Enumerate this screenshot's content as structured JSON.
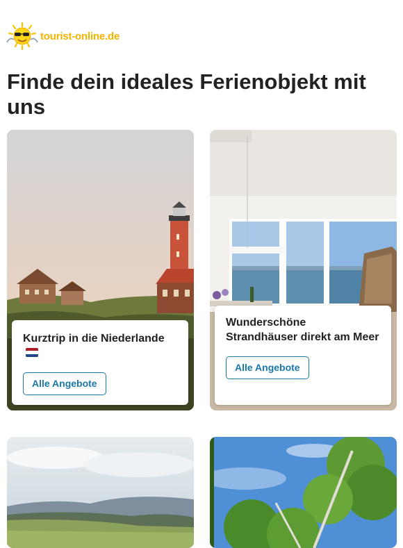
{
  "brand": {
    "name": "tourist-online.de",
    "color": "#f3b400"
  },
  "headline": "Finde dein ideales Ferienobjekt mit uns",
  "cards": [
    {
      "title": "Kurztrip in die Niederlande",
      "flag_icon": "netherlands-flag-icon",
      "button": "Alle Angebote"
    },
    {
      "title": "Wunderschöne Strandhäuser direkt am Meer",
      "button": "Alle Angebote"
    }
  ],
  "colors": {
    "accent": "#1a78a8",
    "text": "#222222"
  }
}
